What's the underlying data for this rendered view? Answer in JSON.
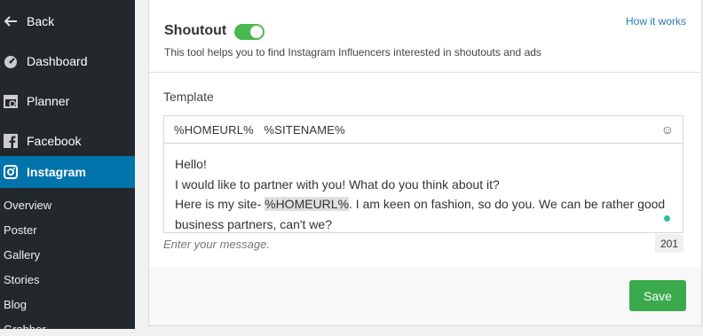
{
  "sidebar": {
    "back_label": "Back",
    "items": [
      {
        "label": "Dashboard",
        "icon": "dashboard-icon"
      },
      {
        "label": "Planner",
        "icon": "calendar-icon"
      },
      {
        "label": "Facebook",
        "icon": "facebook-icon"
      },
      {
        "label": "Instagram",
        "icon": "instagram-icon",
        "active": true
      }
    ],
    "subitems": [
      "Overview",
      "Poster",
      "Gallery",
      "Stories",
      "Blog",
      "Grabber"
    ]
  },
  "card": {
    "title": "Shoutout",
    "toggle_on": true,
    "description": "This tool helps you to find Instagram Influencers interested in shoutouts and ads",
    "how_link": "How it works",
    "template_label": "Template",
    "variables": "%HOMEURL%   %SITENAME%",
    "message": {
      "line1": "Hello!",
      "line2": "I would like to partner with you! What do you think about it?",
      "line3_pre": "Here is my site- ",
      "line3_var": "%HOMEURL%",
      "line3_post": ". I am keen on fashion, so do you. We can be rather good business partners, can't we?"
    },
    "placeholder": "Enter your message.",
    "char_count": "201",
    "save_label": "Save"
  },
  "colors": {
    "sidebar_bg": "#23282d",
    "active_bg": "#0073aa",
    "toggle_on": "#49b94f",
    "save_bg": "#3aaa4c",
    "link": "#2a7ab3"
  }
}
